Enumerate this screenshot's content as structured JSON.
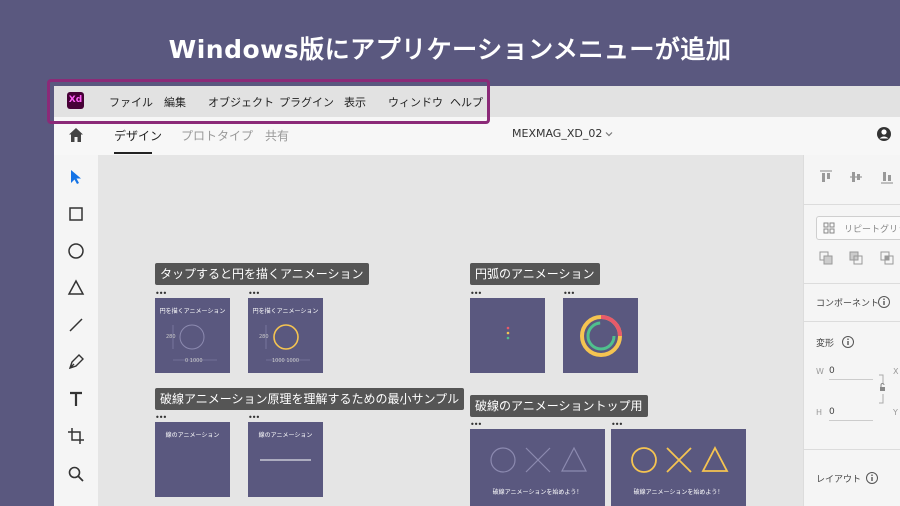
{
  "headline": "Windows版にアプリケーションメニューが追加",
  "app": {
    "logo": "Xd",
    "menu": [
      "ファイル",
      "編集",
      "オブジェクト",
      "プラグイン",
      "表示",
      "ウィンドウ",
      "ヘルプ"
    ],
    "tabs": [
      "デザイン",
      "プロトタイプ",
      "共有"
    ],
    "document_title": "MEXMAG_XD_02"
  },
  "tools": [
    "select-arrow-icon",
    "rectangle-icon",
    "ellipse-icon",
    "polygon-icon",
    "line-icon",
    "pen-icon",
    "text-icon",
    "artboard-icon",
    "zoom-icon"
  ],
  "canvas": {
    "groups": [
      {
        "label": "タップすると円を描くアニメーション"
      },
      {
        "label": "円弧のアニメーション"
      },
      {
        "label": "破線アニメーション原理を理解するための最小サンプル"
      },
      {
        "label": "破線のアニメーショントップ用"
      }
    ],
    "art": {
      "tap1_title": "円を描くアニメーション",
      "tap2_title": "円を描くアニメーション",
      "tap1_num": "280",
      "tap2_num": "280",
      "tap1_bottom": "0    1000",
      "tap2_bottom": "1000  1000",
      "dash1_title": "線のアニメーション",
      "dash2_title": "線のアニメーション",
      "top1_caption": "破線アニメーションを始めよう！",
      "top2_caption": "破線アニメーションを始めよう！"
    }
  },
  "panel": {
    "repeat_grid": "リピートグリッ",
    "component": "コンポーネント",
    "transform": "変形",
    "w_label": "W",
    "w_value": "0",
    "x_label": "X",
    "h_label": "H",
    "h_value": "0",
    "y_label": "Y",
    "layout": "レイアウト"
  },
  "colors": {
    "background": "#5a587f",
    "highlight": "#8b2a78",
    "accent_blue": "#1473e6",
    "arc_yellow": "#f5c451",
    "arc_red": "#e85a6a",
    "arc_green": "#4fc08d"
  }
}
